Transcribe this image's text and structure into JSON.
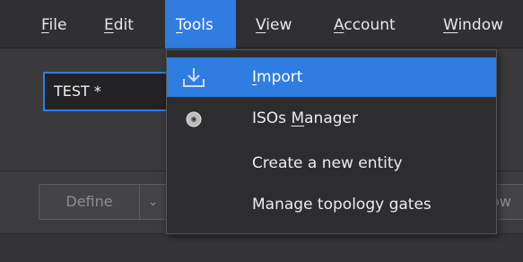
{
  "menubar": {
    "items": [
      {
        "label": "File",
        "mnemonic": "F",
        "rest": "ile"
      },
      {
        "label": "Edit",
        "mnemonic": "E",
        "rest": "dit"
      },
      {
        "label": "Tools",
        "mnemonic": "T",
        "rest": "ools"
      },
      {
        "label": "View",
        "mnemonic": "V",
        "rest": "iew"
      },
      {
        "label": "Account",
        "mnemonic": "A",
        "rest": "ccount"
      },
      {
        "label": "Window",
        "mnemonic": "W",
        "rest": "indow"
      }
    ],
    "active_item": "Tools"
  },
  "entity_tab": {
    "label": "TEST *"
  },
  "toolbar": {
    "define_label": "Define",
    "define_dropdown_glyph": "⌄",
    "partial_right_text": "ow"
  },
  "tools_menu": {
    "items": [
      {
        "label": "Import",
        "icon": "import-icon",
        "highlighted": true,
        "pre": "",
        "mnemonic": "I",
        "post": "mport"
      },
      {
        "label": "ISOs Manager",
        "icon": "disc-icon",
        "highlighted": false,
        "pre": "ISOs ",
        "mnemonic": "M",
        "post": "anager"
      },
      {
        "label": "Create a new entity",
        "icon": "",
        "highlighted": false,
        "pre": "Create a new entity",
        "mnemonic": "",
        "post": ""
      },
      {
        "label": "Manage topology gates",
        "icon": "",
        "highlighted": false,
        "pre": "Manage topology gates",
        "mnemonic": "",
        "post": ""
      }
    ]
  },
  "colors": {
    "accent": "#2f7de1",
    "menubar_bg": "#303033",
    "dropdown_bg": "#2d2d30"
  }
}
